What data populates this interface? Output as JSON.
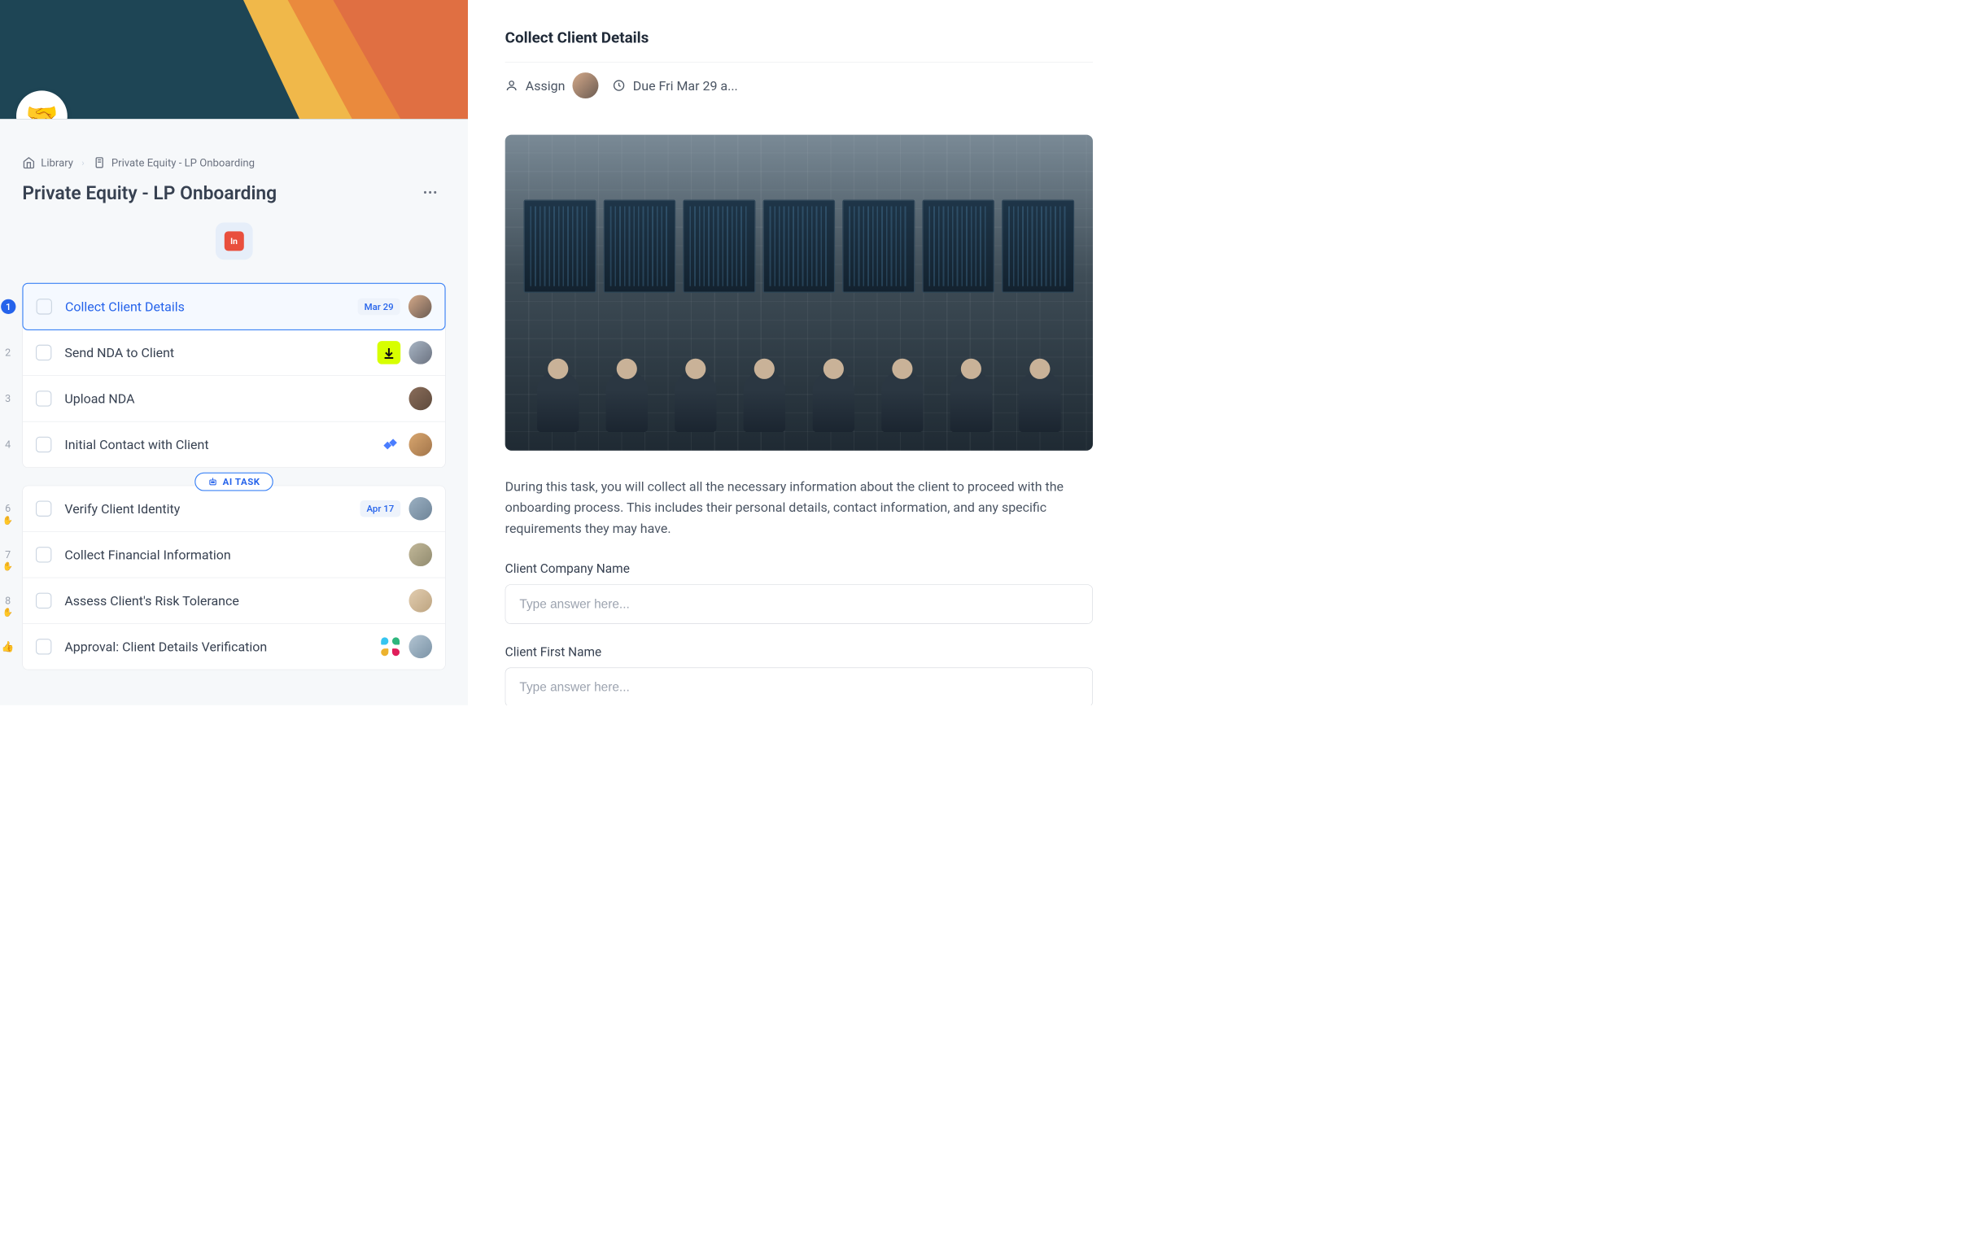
{
  "logo_emoji": "🤝",
  "breadcrumb": {
    "library": "Library",
    "current": "Private Equity - LP Onboarding"
  },
  "page_title": "Private Equity  - LP Onboarding",
  "center_badge": "In",
  "ai_task_label": "AI TASK",
  "tasks_group1": [
    {
      "num": "1",
      "title": "Collect Client Details",
      "date": "Mar 29",
      "selected": true
    },
    {
      "num": "2",
      "title": "Send NDA to Client",
      "icon": "download"
    },
    {
      "num": "3",
      "title": "Upload NDA"
    },
    {
      "num": "4",
      "title": "Initial Contact with Client",
      "icon": "diamond"
    }
  ],
  "tasks_group2": [
    {
      "num": "6",
      "title": "Verify Client Identity",
      "date": "Apr 17",
      "sub": "hand"
    },
    {
      "num": "7",
      "title": "Collect Financial Information",
      "sub": "hand"
    },
    {
      "num": "8",
      "title": "Assess Client's Risk Tolerance",
      "sub": "hand"
    },
    {
      "num": "",
      "title": "Approval: Client Details Verification",
      "icon": "slack",
      "sub": "thumb"
    }
  ],
  "detail": {
    "title": "Collect Client Details",
    "assign_label": "Assign",
    "due_label": "Due Fri Mar 29 a...",
    "description": "During this task, you will collect all the necessary information about the client to proceed with the onboarding process. This includes their personal details, contact information, and any specific requirements they may have.",
    "fields": [
      {
        "label": "Client Company Name",
        "placeholder": "Type answer here..."
      },
      {
        "label": "Client First Name",
        "placeholder": "Type answer here..."
      }
    ]
  }
}
